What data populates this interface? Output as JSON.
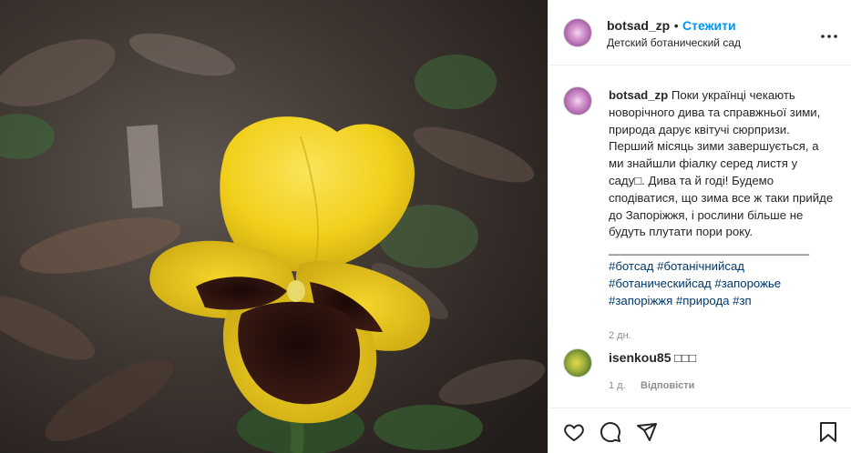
{
  "post": {
    "image_alt": "Yellow pansy flower among dry leaves",
    "header": {
      "username": "botsad_zp",
      "separator": "•",
      "follow_label": "Стежити",
      "location": "Детский ботанический сад",
      "more_label": "•••"
    },
    "caption": {
      "username": "botsad_zp",
      "text": "Поки українці чекають новорічного дива та справжньої зими, природа дарує квітучі сюрпризи. Перший місяць зими завершується, а ми знайшли фіалку серед листя у саду□. Дива та й годі! Будемо сподіватися, що зима все ж таки прийде до Запоріжжя, і рослини більше не будуть плутати пори року.",
      "divider": "______________________________",
      "hashtags": "#ботсад #ботанічнийсад\n#ботаническийсад #запорожье\n#запоріжжя #природа #зп",
      "time": "2 дн."
    },
    "comment": {
      "username": "isenkou85",
      "text": "□□□",
      "time": "1 д.",
      "reply_label": "Відповісти"
    }
  },
  "colors": {
    "link": "#0095f6",
    "hashtag": "#00376b",
    "muted": "#8e8e8e",
    "petal": "#f2d21c",
    "blotch": "#2a120f"
  },
  "icons": [
    "heart-icon",
    "comment-icon",
    "share-icon",
    "bookmark-icon",
    "more-icon"
  ]
}
